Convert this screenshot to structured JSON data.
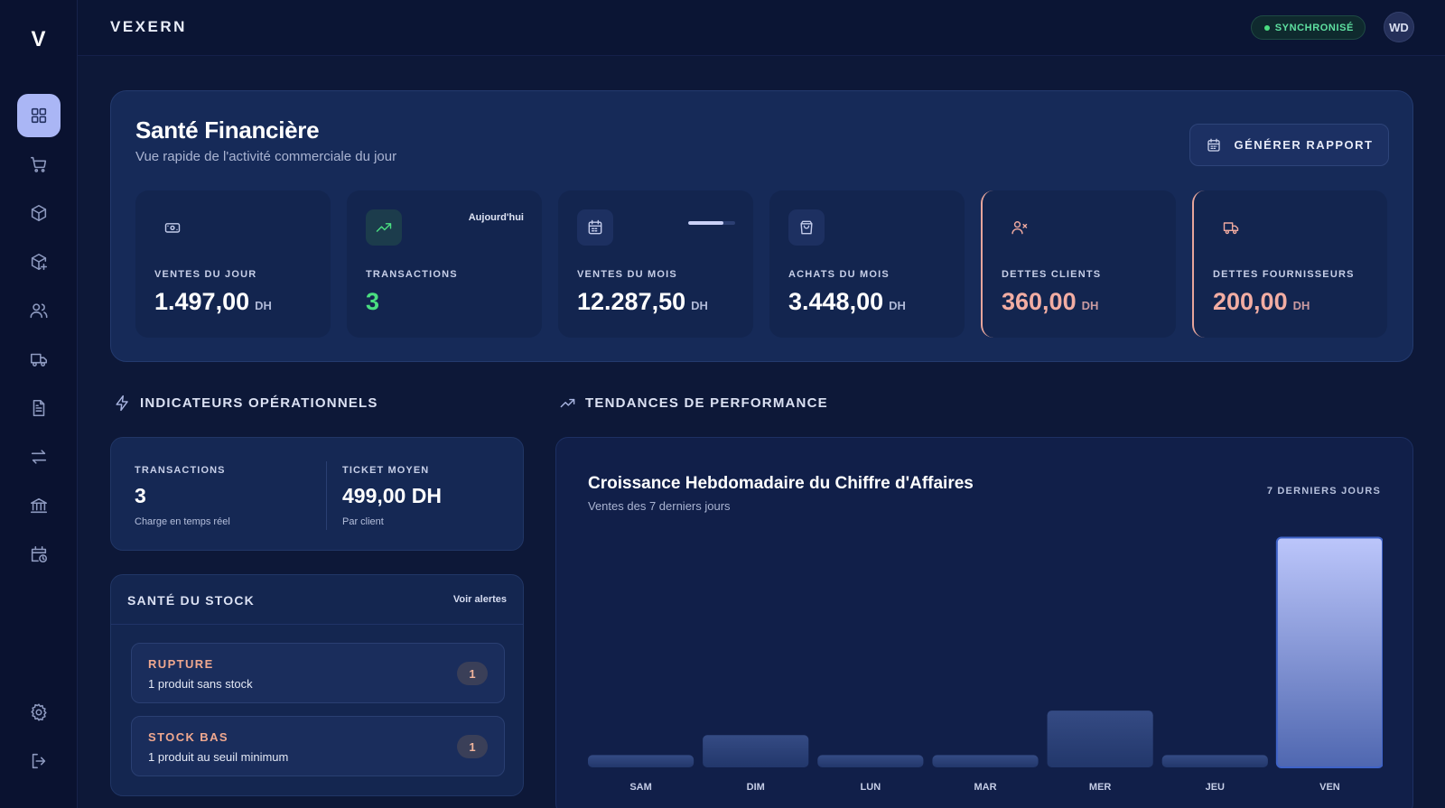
{
  "sidebar": {
    "logo": "V",
    "items": [
      {
        "name": "dashboard",
        "icon": "grid-icon",
        "active": true
      },
      {
        "name": "sales",
        "icon": "cart-icon"
      },
      {
        "name": "products",
        "icon": "box-icon"
      },
      {
        "name": "stock",
        "icon": "box-plus-icon"
      },
      {
        "name": "clients",
        "icon": "users-icon"
      },
      {
        "name": "suppliers",
        "icon": "truck-icon"
      },
      {
        "name": "documents",
        "icon": "document-icon"
      },
      {
        "name": "transfers",
        "icon": "arrows-icon"
      },
      {
        "name": "bank",
        "icon": "bank-icon"
      },
      {
        "name": "history",
        "icon": "calendar-clock-icon"
      }
    ],
    "bottom_items": [
      {
        "name": "settings",
        "icon": "gear-icon"
      },
      {
        "name": "logout",
        "icon": "logout-icon"
      }
    ]
  },
  "topbar": {
    "brand": "VEXERN",
    "sync_label": "SYNCHRONISÉ",
    "avatar_initials": "WD"
  },
  "finance": {
    "title": "Santé Financière",
    "subtitle": "Vue rapide de l'activité commerciale du jour",
    "report_button": "GÉNÉRER RAPPORT",
    "kpis": [
      {
        "label": "VENTES DU JOUR",
        "value": "1.497,00",
        "unit": "DH",
        "icon": "cash-icon"
      },
      {
        "label": "TRANSACTIONS",
        "value": "3",
        "unit": "",
        "icon": "trending-up-icon",
        "tag": "Aujourd'hui"
      },
      {
        "label": "VENTES DU MOIS",
        "value": "12.287,50",
        "unit": "DH",
        "icon": "calendar-icon",
        "progress": 0.75
      },
      {
        "label": "ACHATS DU MOIS",
        "value": "3.448,00",
        "unit": "DH",
        "icon": "shopping-bag-icon"
      },
      {
        "label": "DETTES CLIENTS",
        "value": "360,00",
        "unit": "DH",
        "icon": "user-x-icon"
      },
      {
        "label": "DETTES FOURNISSEURS",
        "value": "200,00",
        "unit": "DH",
        "icon": "truck-icon"
      }
    ]
  },
  "ops": {
    "heading": "INDICATEURS OPÉRATIONNELS",
    "transactions_label": "TRANSACTIONS",
    "transactions_value": "3",
    "transactions_sub": "Charge en temps réel",
    "ticket_label": "TICKET MOYEN",
    "ticket_value": "499,00 DH",
    "ticket_sub": "Par client"
  },
  "stock": {
    "title": "SANTÉ DU STOCK",
    "link": "Voir alertes",
    "alerts": [
      {
        "title": "RUPTURE",
        "desc": "1 produit sans stock",
        "count": "1"
      },
      {
        "title": "STOCK BAS",
        "desc": "1 produit au seuil minimum",
        "count": "1"
      }
    ]
  },
  "trends": {
    "heading": "TENDANCES DE PERFORMANCE",
    "chart_title": "Croissance Hebdomadaire du Chiffre d'Affaires",
    "chart_subtitle": "Ventes des 7 derniers jours",
    "range_label": "7 DERNIERS JOURS"
  },
  "colors": {
    "accent": "#aab6f5",
    "success": "#4ade80",
    "debt": "#f2ada3",
    "warning": "#f0a88f"
  },
  "chart_data": {
    "type": "bar",
    "categories": [
      "SAM",
      "DIM",
      "LUN",
      "MAR",
      "MER",
      "JEU",
      "VEN"
    ],
    "values": [
      80,
      210,
      80,
      80,
      370,
      80,
      1497
    ],
    "highlight_index": 6,
    "ylim": [
      0,
      1500
    ],
    "grid": false
  }
}
